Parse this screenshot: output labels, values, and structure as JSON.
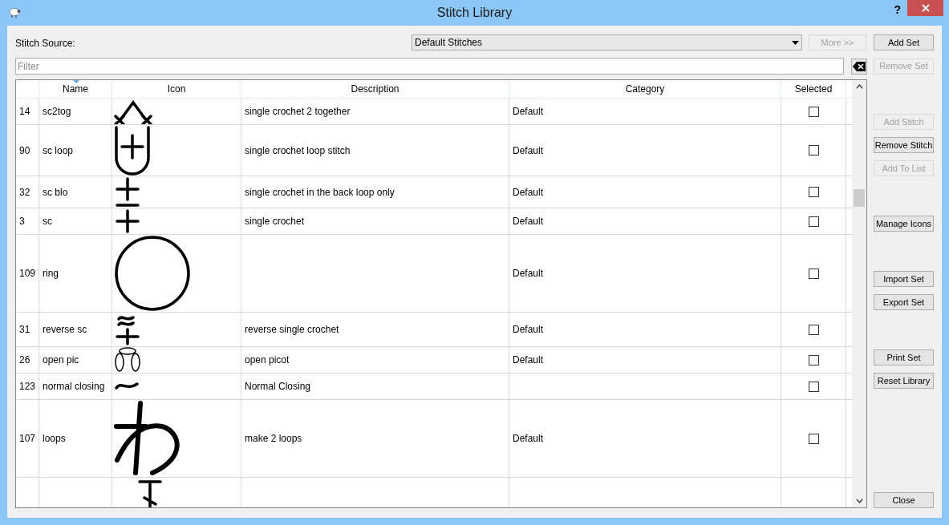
{
  "window": {
    "title": "Stitch Library",
    "help": "?"
  },
  "source": {
    "label": "Stitch Source:",
    "value": "Default Stitches"
  },
  "more_button": {
    "label": "More >>",
    "disabled": true
  },
  "filter": {
    "placeholder": "Filter"
  },
  "top_buttons": [
    {
      "label": "Add Set",
      "disabled": false
    },
    {
      "label": "Remove Set",
      "disabled": true
    }
  ],
  "table": {
    "columns": [
      "Name",
      "Icon",
      "Description",
      "Category",
      "Selected"
    ],
    "rows": [
      {
        "number": "14",
        "name": "sc2tog",
        "description": "single crochet 2 together",
        "category": "Default",
        "selected": false
      },
      {
        "number": "90",
        "name": "sc loop",
        "description": "single crochet loop stitch",
        "category": "Default",
        "selected": false
      },
      {
        "number": "32",
        "name": "sc blo",
        "description": "single crochet in the back loop only",
        "category": "Default",
        "selected": false
      },
      {
        "number": "3",
        "name": "sc",
        "description": "single crochet",
        "category": "Default",
        "selected": false
      },
      {
        "number": "109",
        "name": "ring",
        "category": "Default",
        "selected": false
      },
      {
        "number": "31",
        "name": "reverse sc",
        "description": "reverse single crochet",
        "category": "Default",
        "selected": false
      },
      {
        "number": "26",
        "name": "open pic",
        "description": "open picot",
        "category": "Default",
        "selected": false
      },
      {
        "number": "123",
        "name": "normal closing",
        "description": "Normal Closing",
        "selected": false
      },
      {
        "number": "107",
        "name": "loops",
        "description": "make 2 loops",
        "category": "Default",
        "selected": false
      }
    ]
  },
  "side_button_groups": [
    [
      {
        "label": "Add Stitch",
        "disabled": true
      },
      {
        "label": "Remove Stitch",
        "disabled": false
      },
      {
        "label": "Add To List",
        "disabled": true
      }
    ],
    [
      {
        "label": "Manage Icons",
        "disabled": false
      }
    ],
    [
      {
        "label": "Import Set",
        "disabled": false
      },
      {
        "label": "Export Set",
        "disabled": false
      }
    ],
    [
      {
        "label": "Print Set",
        "disabled": false
      },
      {
        "label": "Reset Library",
        "disabled": false
      }
    ]
  ],
  "close_button": {
    "label": "Close",
    "disabled": false
  }
}
